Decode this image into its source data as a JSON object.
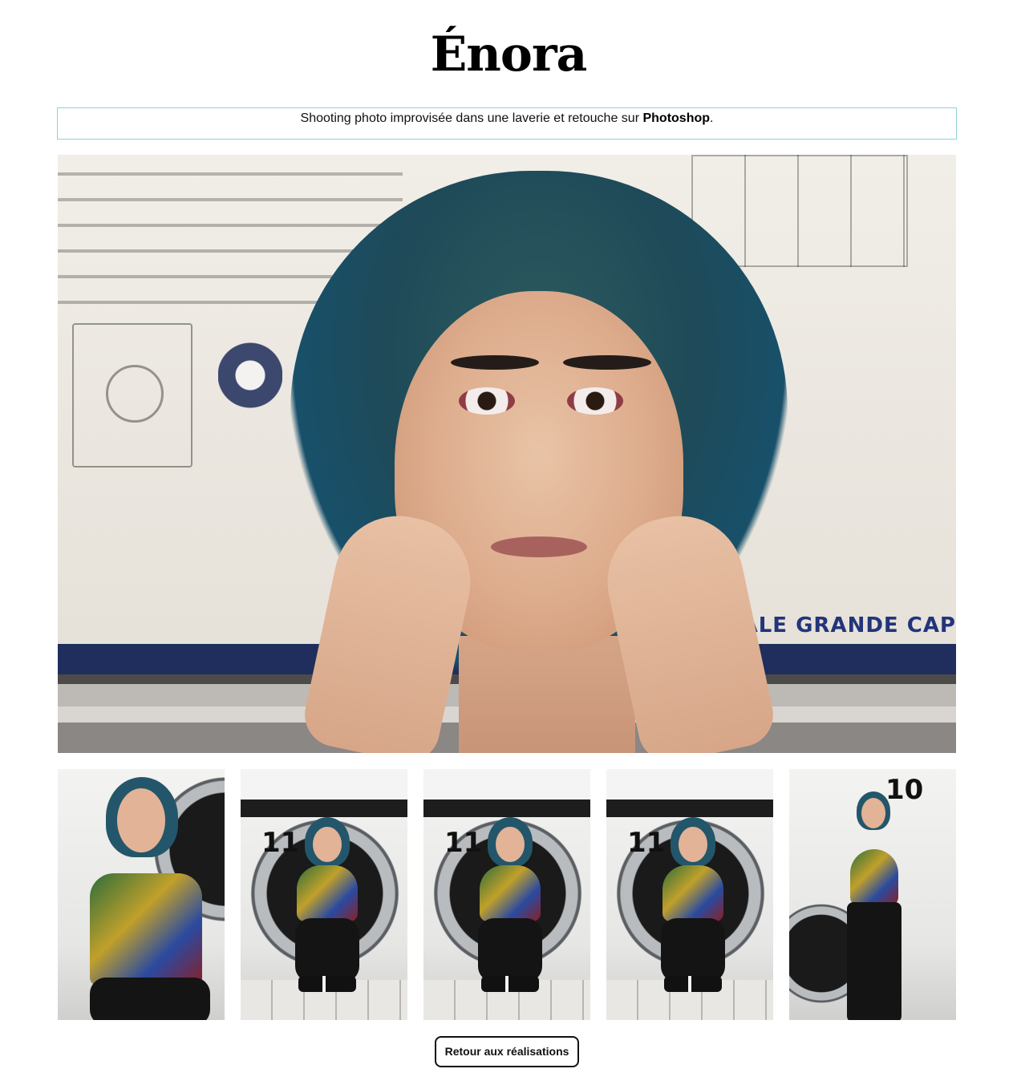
{
  "page": {
    "title": "Énora"
  },
  "description": {
    "text_before": "Shooting photo improvisée dans une laverie et retouche sur ",
    "emphasis": "Photoshop",
    "text_after": "."
  },
  "hero": {
    "band_text": "ALE GRANDE CAP"
  },
  "thumbnails": [
    {
      "number": "",
      "icon": "photo-icon"
    },
    {
      "number": "11",
      "icon": "photo-icon"
    },
    {
      "number": "11",
      "icon": "photo-icon"
    },
    {
      "number": "11",
      "icon": "photo-icon"
    },
    {
      "number": "10",
      "icon": "photo-icon"
    }
  ],
  "actions": {
    "back_label": "Retour aux réalisations"
  },
  "colors": {
    "accent_border": "#8fd0d9",
    "text": "#111111",
    "background": "#ffffff"
  }
}
